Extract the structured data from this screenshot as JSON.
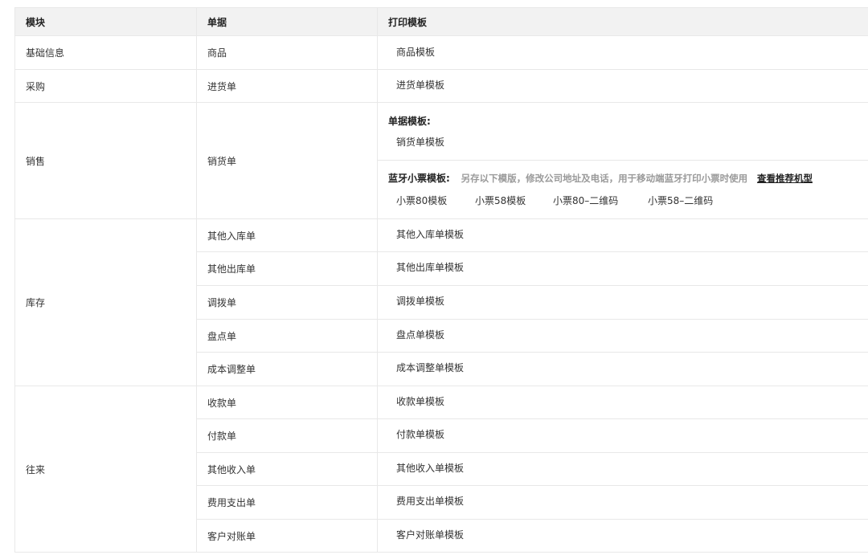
{
  "header": {
    "module": "模块",
    "document": "单据",
    "template": "打印模板"
  },
  "rows": [
    {
      "module": "基础信息",
      "document": "商品",
      "template": "商品模板"
    },
    {
      "module": "采购",
      "document": "进货单",
      "template": "进货单模板"
    }
  ],
  "sales": {
    "module": "销售",
    "document": "销货单",
    "doc_template_title": "单据模板:",
    "doc_template": "销货单模板",
    "bt_title": "蓝牙小票模板:",
    "bt_hint": "另存以下模版，修改公司地址及电话，用于移动端蓝牙打印小票时使用",
    "bt_recommend": "查看推荐机型",
    "bt_templates": [
      "小票80模板",
      "小票58模板",
      "小票80–二维码",
      "小票58–二维码"
    ]
  },
  "inventory": {
    "module": "库存",
    "items": [
      {
        "document": "其他入库单",
        "template": "其他入库单模板"
      },
      {
        "document": "其他出库单",
        "template": "其他出库单模板"
      },
      {
        "document": "调拨单",
        "template": "调拨单模板"
      },
      {
        "document": "盘点单",
        "template": "盘点单模板"
      },
      {
        "document": "成本调整单",
        "template": "成本调整单模板"
      }
    ]
  },
  "finance": {
    "module": "往来",
    "items": [
      {
        "document": "收款单",
        "template": "收款单模板"
      },
      {
        "document": "付款单",
        "template": "付款单模板"
      },
      {
        "document": "其他收入单",
        "template": "其他收入单模板"
      },
      {
        "document": "费用支出单",
        "template": "费用支出单模板"
      },
      {
        "document": "客户对账单",
        "template": "客户对账单模板"
      }
    ]
  }
}
